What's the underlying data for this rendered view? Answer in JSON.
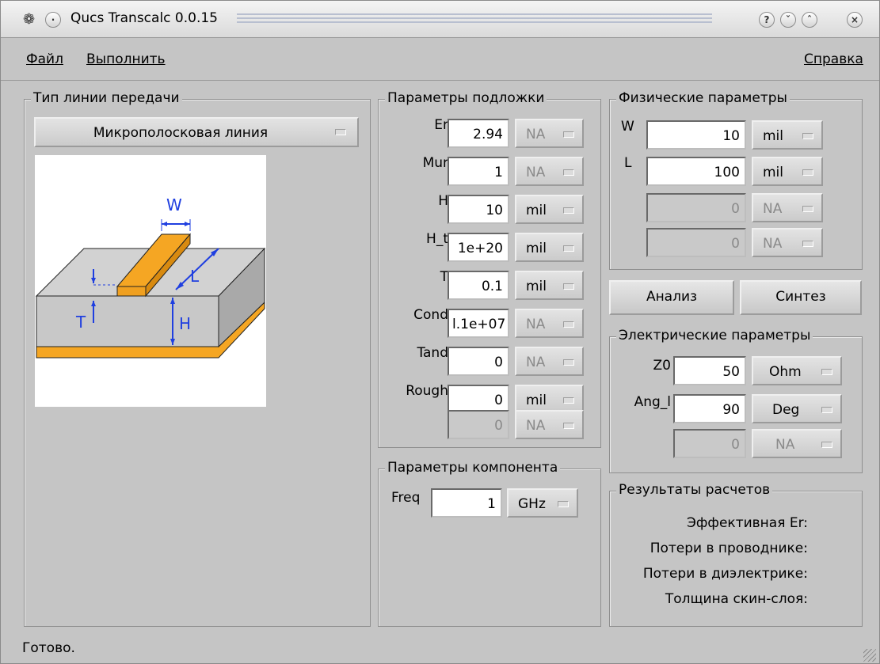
{
  "window": {
    "title": "Qucs Transcalc 0.0.15"
  },
  "menu": {
    "file": "Файл",
    "run": "Выполнить",
    "help": "Справка"
  },
  "line_type": {
    "title": "Тип линии передачи",
    "selected": "Микрополосковая линия"
  },
  "diagram": {
    "w": "W",
    "l": "L",
    "t": "T",
    "h": "H",
    "colors": {
      "strip": "#f5a623",
      "substrate": "#c8c8c8",
      "arrows": "#1f3fe0"
    }
  },
  "substrate": {
    "title": "Параметры подложки",
    "rows": [
      {
        "label": "Er",
        "value": "2.94",
        "unit": "NA"
      },
      {
        "label": "Mur",
        "value": "1",
        "unit": "NA"
      },
      {
        "label": "H",
        "value": "10",
        "unit": "mil"
      },
      {
        "label": "H_t",
        "value": "1e+20",
        "unit": "mil"
      },
      {
        "label": "T",
        "value": "0.1",
        "unit": "mil"
      },
      {
        "label": "Cond",
        "value": "l.1e+07",
        "unit": "NA"
      },
      {
        "label": "Tand",
        "value": "0",
        "unit": "NA"
      },
      {
        "label": "Rough",
        "value": "0",
        "unit": "mil"
      },
      {
        "label": "",
        "value": "0",
        "unit": "NA"
      }
    ]
  },
  "component": {
    "title": "Параметры компонента",
    "label": "Freq",
    "value": "1",
    "unit": "GHz"
  },
  "physical": {
    "title": "Физические параметры",
    "rows": [
      {
        "label": "W",
        "value": "10",
        "unit": "mil"
      },
      {
        "label": "L",
        "value": "100",
        "unit": "mil"
      },
      {
        "label": "",
        "value": "0",
        "unit": "NA"
      },
      {
        "label": "",
        "value": "0",
        "unit": "NA"
      }
    ]
  },
  "buttons": {
    "analyze": "Анализ",
    "synthesize": "Синтез"
  },
  "electrical": {
    "title": "Электрические параметры",
    "rows": [
      {
        "label": "Z0",
        "value": "50",
        "unit": "Ohm"
      },
      {
        "label": "Ang_l",
        "value": "90",
        "unit": "Deg"
      },
      {
        "label": "",
        "value": "0",
        "unit": "NA"
      }
    ]
  },
  "results": {
    "title": "Результаты расчетов",
    "lines": [
      "Эффективная Er:",
      "Потери в проводнике:",
      "Потери в диэлектрике:",
      "Толщина скин-слоя:"
    ]
  },
  "status": {
    "text": "Готово."
  }
}
